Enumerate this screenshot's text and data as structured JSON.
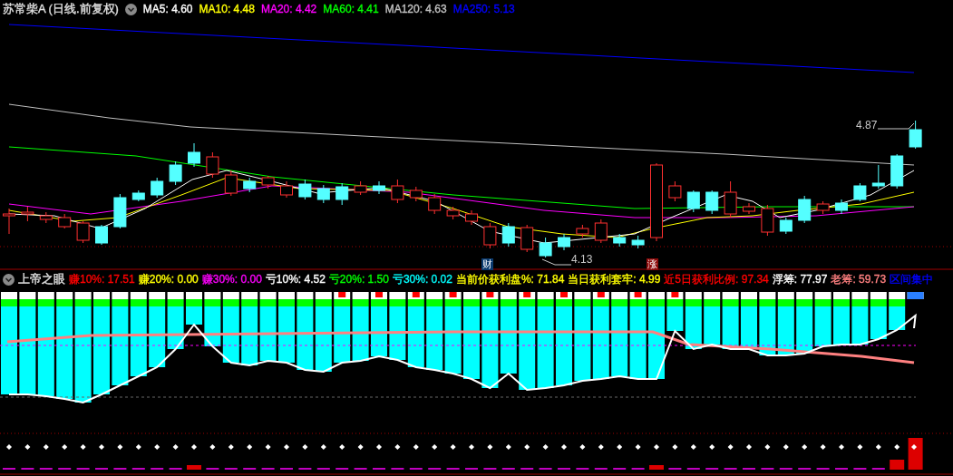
{
  "main_panel": {
    "title": "苏常柴A",
    "period": "(日线.前复权)",
    "indicators": [
      {
        "text": "MA5: 4.60",
        "color": "#ffffff"
      },
      {
        "text": "MA10: 4.48",
        "color": "#ffff00"
      },
      {
        "text": "MA20: 4.42",
        "color": "#ff00ff"
      },
      {
        "text": "MA60: 4.41",
        "color": "#00ff00"
      },
      {
        "text": "MA120: 4.63",
        "color": "#c0c0c0"
      },
      {
        "text": "MA250: 5.13",
        "color": "#0000ff"
      }
    ],
    "price_labels": [
      "4.87",
      "4.13"
    ],
    "markers": [
      {
        "text": "财",
        "color": "#0a3a6e"
      },
      {
        "text": "涨",
        "color": "#8c0a0a"
      }
    ]
  },
  "sub_panel": {
    "title": "上帝之眼",
    "indicators": [
      {
        "text": "赚10%: 17.51",
        "color": "#ff0000"
      },
      {
        "text": "赚20%: 0.00",
        "color": "#ffff00"
      },
      {
        "text": "赚30%: 0.00",
        "color": "#ff00ff"
      },
      {
        "text": "亏10%: 4.52",
        "color": "#ffffff"
      },
      {
        "text": "亏20%: 1.50",
        "color": "#00ff00"
      },
      {
        "text": "亏30%: 0.02",
        "color": "#00ffff"
      },
      {
        "text": "当前价获利盘%: 71.84",
        "color": "#ffff00"
      },
      {
        "text": "当日获利套牢: 4.99",
        "color": "#ffff00"
      },
      {
        "text": "近5日获利比例: 97.34",
        "color": "#ff0000"
      },
      {
        "text": "浮筹: 77.97",
        "color": "#ffffff"
      },
      {
        "text": "老筹: 59.73",
        "color": "#ff8080"
      },
      {
        "text": "区间集中",
        "color": "#0000ff"
      }
    ]
  }
}
